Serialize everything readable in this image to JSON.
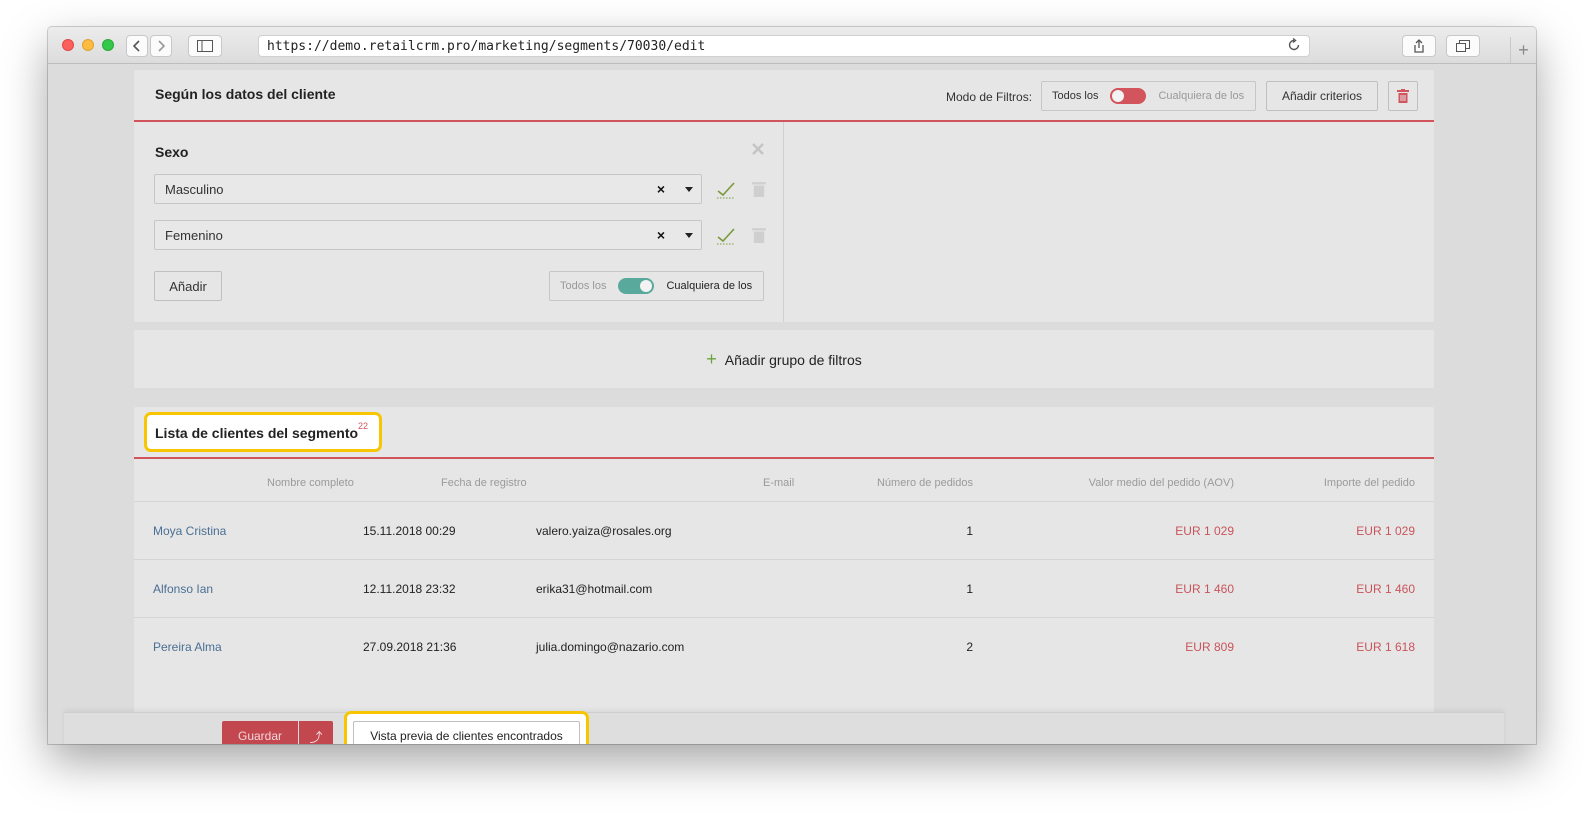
{
  "browser": {
    "url": "https://demo.retailcrm.pro/marketing/segments/70030/edit",
    "new_tab_symbol": "+"
  },
  "criteria_panel": {
    "title": "Según los datos del cliente",
    "filter_mode_label": "Modo de Filtros:",
    "mode_all": "Todos los",
    "mode_any": "Cualquiera de los",
    "add_criteria": "Añadir criterios"
  },
  "sexo_filter": {
    "title": "Sexo",
    "values": [
      "Masculino",
      "Femenino"
    ],
    "clear_symbol": "×",
    "add_button": "Añadir",
    "mode_all": "Todos los",
    "mode_any": "Cualquiera de los"
  },
  "add_group": {
    "symbol": "+",
    "label": "Añadir grupo de filtros"
  },
  "client_list": {
    "title": "Lista de clientes del segmento",
    "count": "22",
    "columns": [
      "Nombre completo",
      "Fecha de registro",
      "E-mail",
      "Número de pedidos",
      "Valor medio del pedido (AOV)",
      "Importe del pedido"
    ],
    "rows": [
      {
        "name": "Moya Cristina",
        "date": "15.11.2018 00:29",
        "email": "valero.yaiza@rosales.org",
        "orders": "1",
        "aov": "EUR 1 029",
        "total": "EUR 1 029"
      },
      {
        "name": "Alfonso Ian",
        "date": "12.11.2018 23:32",
        "email": "erika31@hotmail.com",
        "orders": "1",
        "aov": "EUR 1 460",
        "total": "EUR 1 460"
      },
      {
        "name": "Pereira Alma",
        "date": "27.09.2018 21:36",
        "email": "julia.domingo@nazario.com",
        "orders": "2",
        "aov": "EUR 809",
        "total": "EUR 1 618"
      }
    ]
  },
  "footer": {
    "save": "Guardar",
    "save_menu_symbol": "⤴",
    "preview": "Vista previa de clientes encontrados"
  },
  "colors": {
    "accent_red": "#d2545d",
    "switch_green": "#5aa99d",
    "highlight": "#f7c600"
  }
}
